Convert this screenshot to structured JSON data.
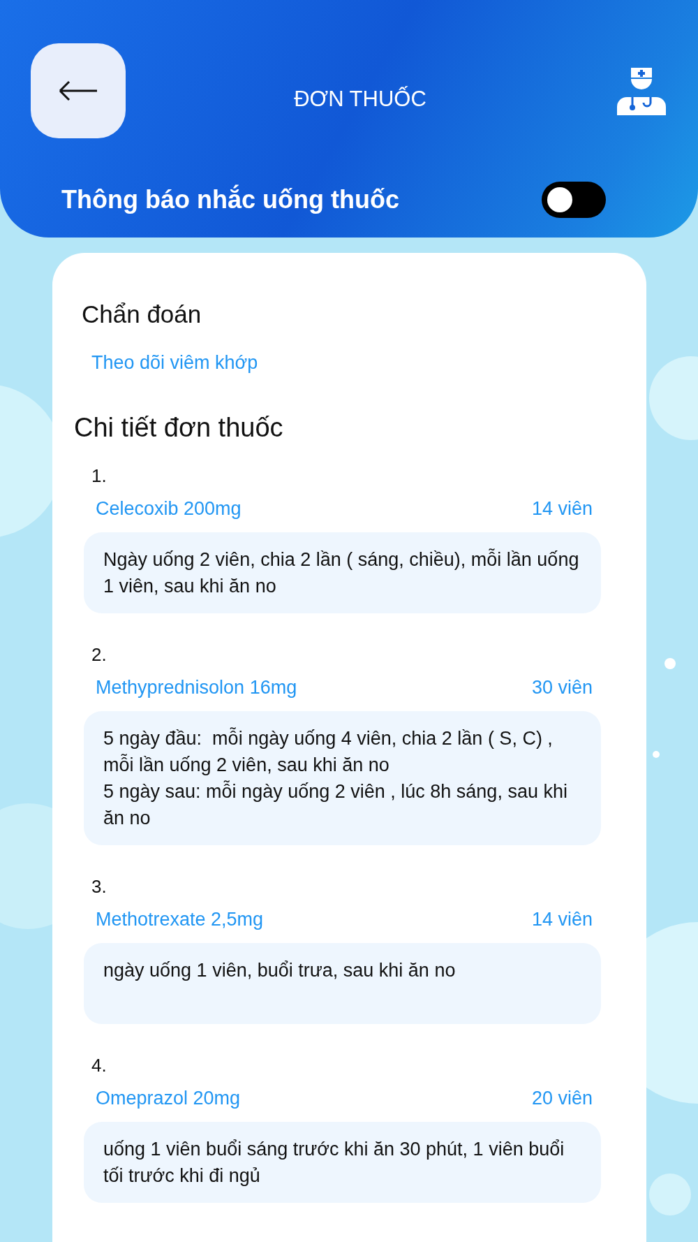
{
  "header": {
    "title": "ĐƠN THUỐC"
  },
  "reminder": {
    "label": "Thông báo nhắc uống thuốc",
    "on": false
  },
  "diagnosis": {
    "heading": "Chẩn đoán",
    "value": "Theo dõi viêm khớp"
  },
  "prescription": {
    "heading": "Chi tiết đơn thuốc",
    "items": [
      {
        "number": "1.",
        "name": "Celecoxib 200mg",
        "quantity": "14 viên",
        "instructions": "Ngày uống 2 viên, chia 2 lần ( sáng, chiều), mỗi lần uống 1 viên, sau khi ăn no"
      },
      {
        "number": "2.",
        "name": "Methyprednisolon 16mg",
        "quantity": "30 viên",
        "instructions": "5 ngày đầu:  mỗi ngày uống 4 viên, chia 2 lần ( S, C) , mỗi lần uống 2 viên, sau khi ăn no\n5 ngày sau: mỗi ngày uống 2 viên , lúc 8h sáng, sau khi ăn no"
      },
      {
        "number": "3.",
        "name": "Methotrexate 2,5mg",
        "quantity": "14 viên",
        "instructions": "ngày uống 1 viên, buổi trưa, sau khi ăn no"
      },
      {
        "number": "4.",
        "name": "Omeprazol 20mg",
        "quantity": "20 viên",
        "instructions": "uống 1 viên buổi sáng trước khi ăn 30 phút, 1 viên buổi tối trước khi đi ngủ"
      }
    ]
  }
}
